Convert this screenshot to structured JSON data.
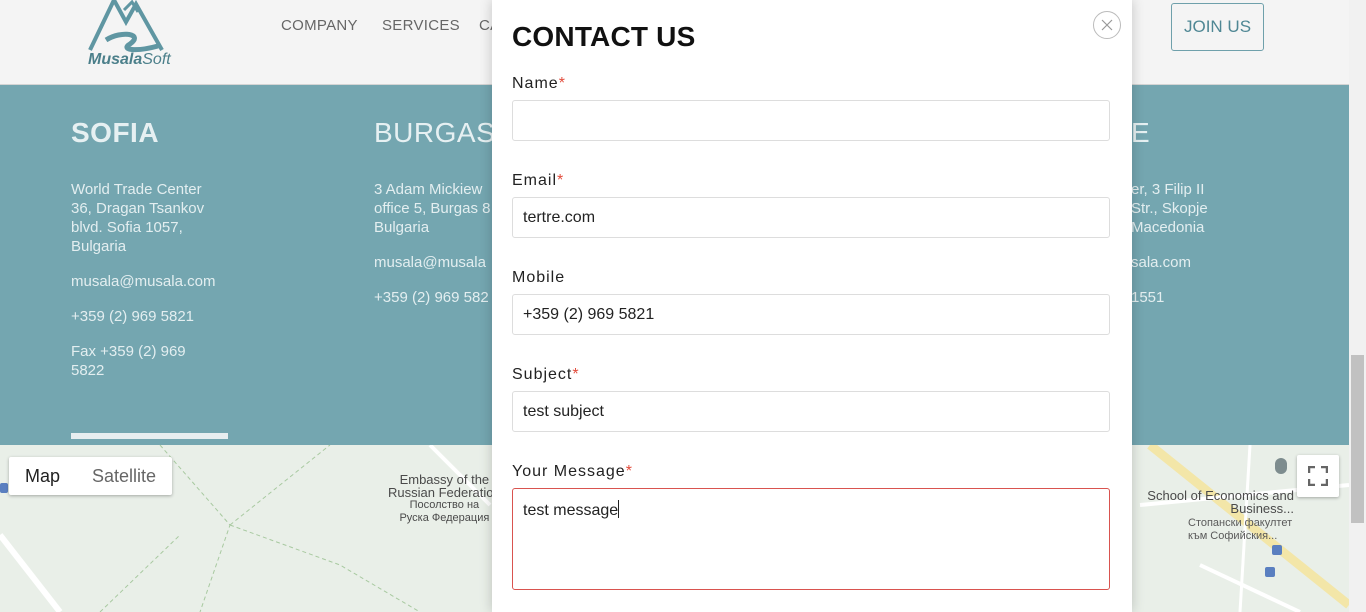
{
  "header": {
    "logo_main": "Musala",
    "logo_sub": "Soft",
    "nav": [
      "COMPANY",
      "SERVICES",
      "CA"
    ],
    "join_label": "JOIN US"
  },
  "offices": {
    "sofia": {
      "city": "SOFIA",
      "address": [
        "World Trade Center",
        "36, Dragan Tsankov",
        "blvd. Sofia 1057,",
        "Bulgaria"
      ],
      "email": "musala@musala.com",
      "phone": "+359 (2) 969 5821",
      "fax": [
        "Fax +359 (2) 969",
        "5822"
      ]
    },
    "burgas": {
      "city": "BURGAS",
      "address": [
        "3 Adam Mickiew",
        "office 5, Burgas 8",
        "Bulgaria"
      ],
      "email": "musala@musala",
      "phone": "+359 (2) 969 582"
    },
    "skopje": {
      "city": "E",
      "address": [
        "er, 3 Filip II",
        "Str., Skopje",
        "Macedonia"
      ],
      "email": "sala.com",
      "phone": "1551"
    }
  },
  "map": {
    "map_label": "Map",
    "satellite_label": "Satellite",
    "embassy": [
      "Embassy of the",
      "Russian Federation",
      "Посолство на",
      "Руска Федерация"
    ],
    "school": [
      "School of Economics and",
      "Business..."
    ],
    "school_bg": [
      "Стопански факултет",
      "към Софийския..."
    ]
  },
  "modal": {
    "title": "CONTACT US",
    "close_icon": "close-icon",
    "fields": {
      "name": {
        "label": "Name",
        "required": "*",
        "value": ""
      },
      "email": {
        "label": "Email",
        "required": "*",
        "value": "tertre.com"
      },
      "mobile": {
        "label": "Mobile",
        "value": "+359 (2) 969 5821"
      },
      "subject": {
        "label": "Subject",
        "required": "*",
        "value": "test subject"
      },
      "message": {
        "label": "Your Message",
        "required": "*",
        "value": "test message"
      }
    }
  },
  "colors": {
    "band": "#74a6b0",
    "accent": "#4f8794",
    "required": "#e24b3b",
    "error_border": "#d9534f"
  }
}
